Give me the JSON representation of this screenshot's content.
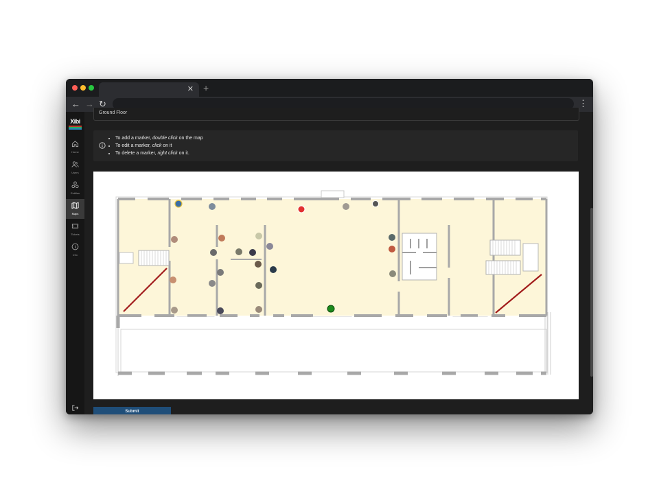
{
  "sidebar": {
    "logo_text": "Xibi",
    "items": [
      {
        "label": "Home",
        "icon": "home-icon"
      },
      {
        "label": "Users",
        "icon": "users-icon"
      },
      {
        "label": "Entities",
        "icon": "entities-icon"
      },
      {
        "label": "Maps",
        "icon": "map-icon"
      },
      {
        "label": "Tickets",
        "icon": "ticket-icon"
      },
      {
        "label": "Info",
        "icon": "info-icon"
      }
    ],
    "active": "Maps"
  },
  "floor_select": {
    "value": "Ground Floor"
  },
  "instructions": {
    "line1_pre": "To add a marker, ",
    "line1_em": "double click",
    "line1_post": " on the map",
    "line2_pre": "To edit a marker, ",
    "line2_em": "click",
    "line2_post": " on it",
    "line3_pre": "To delete a marker, ",
    "line3_em": "right click",
    "line3_post": " on it."
  },
  "submit_button": {
    "label": "Submit"
  },
  "colors": {
    "floor_fill": "#fdf6d9",
    "wall": "#9e9e9e",
    "stair_line": "#a11b1b",
    "accent_button": "#1f4e79"
  }
}
